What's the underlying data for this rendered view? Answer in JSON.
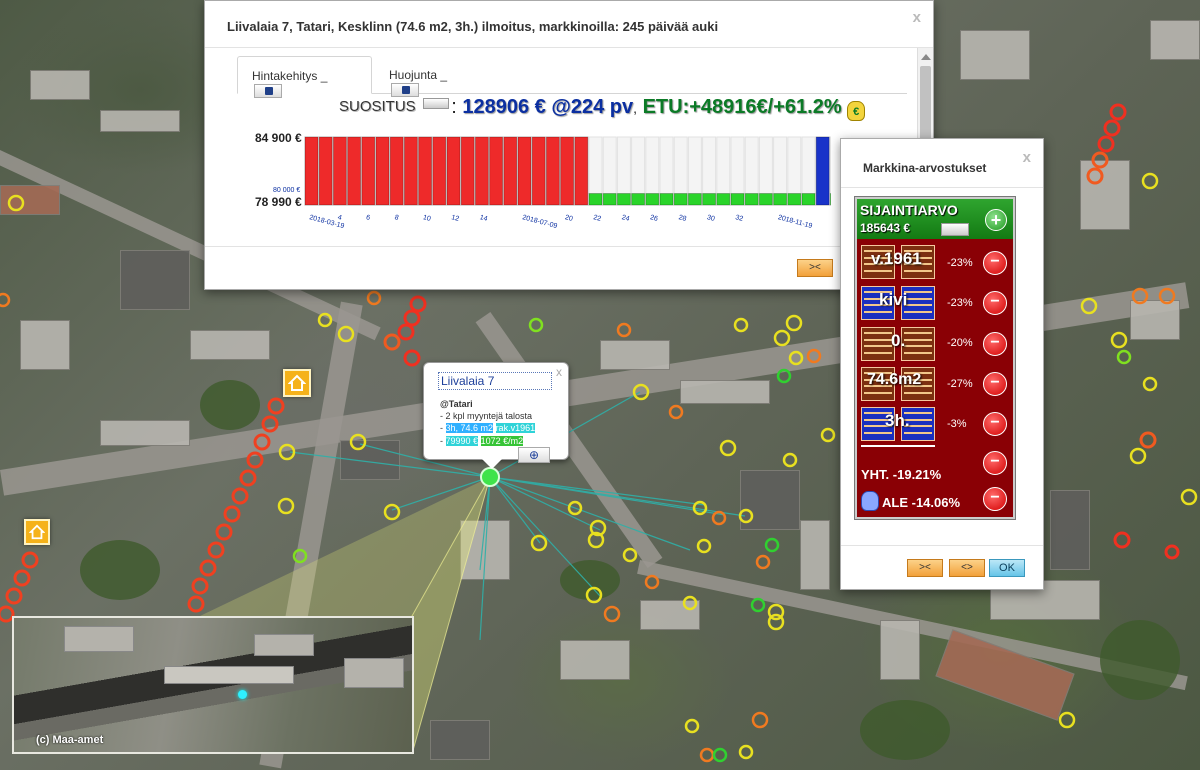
{
  "map": {
    "copyright": "(c) Maa-amet"
  },
  "listing_dialog": {
    "title": "Liivalaia 7, Tatari, Kesklinn (74.6 m2, 3h.) ilmoitus, markkinoilla: 245 päivää auki",
    "close_label": "x",
    "tabs": [
      {
        "label": "Hintakehitys _",
        "active": true
      },
      {
        "label": "Huojunta _",
        "active": false
      }
    ],
    "recommendation": {
      "label": "SUOSITUS",
      "separator": ":",
      "price": "128906 € @224 pv",
      "comma": ",",
      "gain": "ETU:+48916€/+61.2%",
      "bag_symbol": "€"
    },
    "footer": {
      "collapse_label": "><"
    }
  },
  "chart_data": {
    "type": "bar",
    "title": "",
    "ylim": [
      78990,
      84900
    ],
    "y_tick_labels": [
      "84 900 €",
      "78 990 €"
    ],
    "marker_label": "80 000 €",
    "x_tick_labels": [
      "2018-03-19",
      "4",
      "6",
      "8",
      "10",
      "12",
      "14",
      "2018-07-09",
      "20",
      "22",
      "24",
      "26",
      "28",
      "30",
      "32",
      "2018-11-19"
    ],
    "series": [
      {
        "color": "#ee2a2a",
        "values": [
          84900,
          84900,
          84900,
          84900,
          84900,
          84900,
          84900,
          84900,
          84900,
          84900,
          84900,
          84900,
          84900,
          84900,
          84900,
          84900,
          84900,
          84900,
          84900,
          84900
        ]
      },
      {
        "color": "#2ad42a",
        "values": [
          79990,
          79990,
          79990,
          79990,
          79990,
          79990,
          79990,
          79990,
          79990,
          79990,
          79990,
          79990,
          79990,
          79990,
          79990,
          79990,
          79990
        ]
      },
      {
        "color": "#1933c9",
        "values": [
          84900
        ]
      }
    ]
  },
  "valuation_dialog": {
    "title": "Markkina-arvostukset",
    "close_label": "x",
    "location_value": {
      "label": "SIJAINTIARVO",
      "value": "185643 €",
      "plus_label": "+"
    },
    "factors": [
      {
        "text": "v.1961",
        "pct": "-23%"
      },
      {
        "text": "kivi",
        "pct": "-23%"
      },
      {
        "text": "0.",
        "pct": "-20%"
      },
      {
        "text": "74.6m2",
        "pct": "-27%"
      },
      {
        "text": "3h.",
        "pct": "-3%"
      }
    ],
    "minus_label": "−",
    "total": "YHT. -19.21%",
    "discount": "ALE -14.06%",
    "buttons": {
      "collapse": "><",
      "expand": "<>",
      "ok": "OK"
    }
  },
  "popup": {
    "title": "Liivalaia 7",
    "close_label": "x",
    "district": "@Tatari",
    "line_sold": "- 2 kpl myyntejä talosta",
    "dash": "-",
    "spec_rooms": "3h, 74.6 m2",
    "spec_year": "rak.v1961",
    "price": "79990 €",
    "price_sqm": "1072 €/m2",
    "zoom_symbol": "⊕"
  },
  "colors": {
    "price_blue": "#0b2fa1",
    "gain_green": "#0b7a26",
    "panel_red": "#8a0005",
    "head_green": "#1f941f"
  }
}
